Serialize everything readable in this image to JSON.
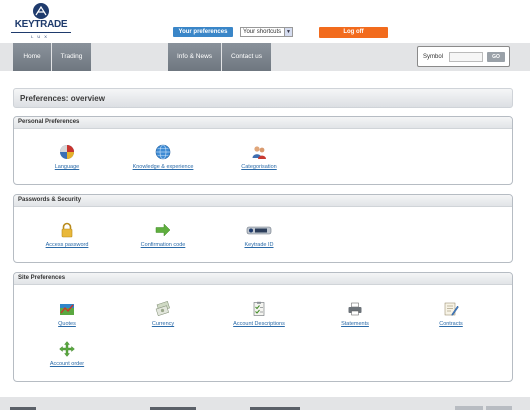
{
  "header": {
    "logo_brand": "KEYTRADE",
    "logo_sub": "LUX",
    "preferences_button": "Your preferences",
    "shortcuts_select": "Your shortcuts",
    "logoff_button": "Log off"
  },
  "nav": {
    "tabs": [
      {
        "label": "Home"
      },
      {
        "label": "Trading"
      },
      {
        "label": "Info & News"
      },
      {
        "label": "Contact us"
      }
    ],
    "symbol_label": "Symbol",
    "symbol_value": "",
    "go_button": "GO"
  },
  "page_title": "Preferences: overview",
  "sections": [
    {
      "title": "Personal Preferences",
      "items": [
        {
          "label": "Language",
          "icon": "flag-globe-icon"
        },
        {
          "label": "Knowledge & experience",
          "icon": "globe-icon"
        },
        {
          "label": "Categorisation",
          "icon": "users-icon"
        }
      ]
    },
    {
      "title": "Passwords & Security",
      "items": [
        {
          "label": "Access password",
          "icon": "lock-icon"
        },
        {
          "label": "Confirmation code",
          "icon": "arrow-right-icon"
        },
        {
          "label": "Keytrade ID",
          "icon": "keytrade-id-device-icon"
        }
      ]
    },
    {
      "title": "Site Preferences",
      "items": [
        {
          "label": "Quotes",
          "icon": "chart-icon"
        },
        {
          "label": "Currency",
          "icon": "banknotes-icon"
        },
        {
          "label": "Account Descriptions",
          "icon": "checklist-icon"
        },
        {
          "label": "Statements",
          "icon": "printer-icon"
        },
        {
          "label": "Contracts",
          "icon": "pencil-document-icon"
        },
        {
          "label": "Account order",
          "icon": "move-arrows-icon"
        }
      ]
    }
  ],
  "colors": {
    "brand_navy": "#1f3b6d",
    "preferences_blue": "#3a86c8",
    "logoff_orange": "#f26b1d",
    "link_blue": "#2a6aa8"
  }
}
